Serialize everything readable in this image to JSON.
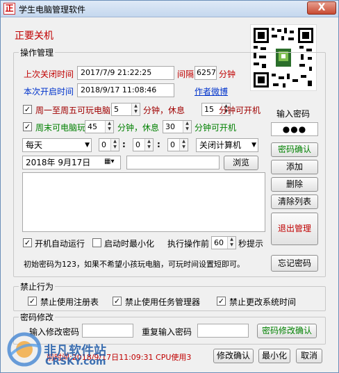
{
  "window": {
    "title": "学生电脑管理软件",
    "app_icon_char": "正",
    "close_symbol": "X"
  },
  "header": {
    "status_text": "正要关机"
  },
  "ops_group": {
    "title": "操作管理",
    "last_shutdown_label": "上次关闭时间",
    "last_shutdown_value": "2017/7/9 21:22:25",
    "interval_label": "间隔",
    "interval_value": "6257",
    "interval_unit": "分钟",
    "this_boot_label": "本次开启时间",
    "this_boot_value": "2018/9/17 11:08:46",
    "author_link": "作者微博",
    "weekday_check_label": "周一至周五可玩电脑",
    "weekday_minutes": "5",
    "weekday_rest_prefix": "分钟，休息",
    "weekday_rest_value": "15",
    "weekday_suffix": "分钟可开机",
    "weekend_check_label": "周末可电脑玩",
    "weekend_minutes": "45",
    "weekend_rest_prefix": "分钟，休息",
    "weekend_rest_value": "30",
    "weekend_suffix": "分钟可开机",
    "schedule_select": "每天",
    "hour_value": "0",
    "minute_value": "0",
    "second_value": "0",
    "time_sep": ":",
    "action_select": "关闭计算机",
    "date_value": "2018年  9月17日",
    "browse_button": "浏览",
    "autostart_label": "开机自动运行",
    "minimize_label": "启动时最小化",
    "pre_action_label": "执行操作前",
    "pre_action_value": "60",
    "pre_action_suffix": "秒提示",
    "hint_text": "初始密码为123，如果不希望小孩玩电脑，可玩时间设置短即可。"
  },
  "side": {
    "password_label": "输入密码",
    "password_mask": "●●●",
    "confirm_pw_button": "密码确认",
    "add_button": "添加",
    "delete_button": "删除",
    "clear_list_button": "清除列表",
    "exit_button": "退出管理",
    "forgot_button": "忘记密码"
  },
  "forbid_group": {
    "title": "禁止行为",
    "regedit_label": "禁止使用注册表",
    "taskmgr_label": "禁止使用任务管理器",
    "systime_label": "禁止更改系统时间"
  },
  "pwchange_group": {
    "title": "密码修改",
    "new_pw_label": "输入修改密码",
    "repeat_pw_label": "重复输入密码",
    "confirm_button": "密码修改确认"
  },
  "footer": {
    "status_text": "前时间:2018/9/17日11:09:31 CPU使用3",
    "modify_button": "修改确认",
    "minimize_button": "最小化",
    "cancel_button": "取消"
  },
  "watermark": {
    "line1": "非凡软件站",
    "line2": "CRSKY.com"
  },
  "colors": {
    "red": "#c00000",
    "blue": "#0033cc",
    "green": "#008000"
  }
}
